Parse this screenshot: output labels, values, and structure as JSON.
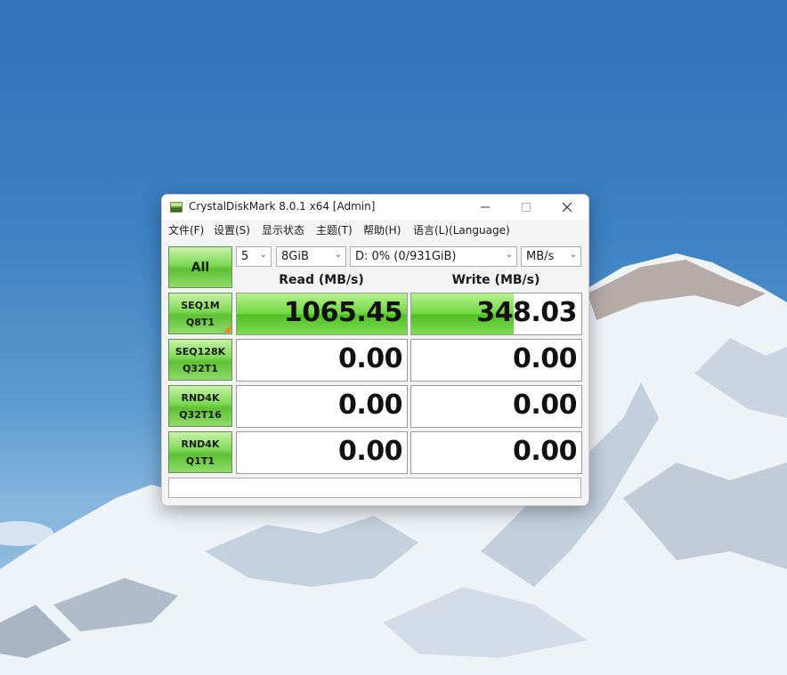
{
  "window": {
    "title": "CrystalDiskMark 8.0.1 x64 [Admin]"
  },
  "menu": [
    {
      "label": "文件(F)"
    },
    {
      "label": "设置(S)"
    },
    {
      "label": "显示状态"
    },
    {
      "label": "主题(T)"
    },
    {
      "label": "帮助(H)"
    },
    {
      "label": "语言(L)(Language)"
    }
  ],
  "controls": {
    "all_label": "All",
    "count_value": "5",
    "size_value": "8GiB",
    "drive_value": "D: 0% (0/931GiB)",
    "unit_value": "MB/s"
  },
  "headers": {
    "read": "Read (MB/s)",
    "write": "Write (MB/s)"
  },
  "tests": [
    {
      "line1": "SEQ1M",
      "line2": "Q8T1",
      "read": "1065.45",
      "write": "348.03",
      "read_fill": 1.0,
      "write_fill": 0.6
    },
    {
      "line1": "SEQ128K",
      "line2": "Q32T1",
      "read": "0.00",
      "write": "0.00",
      "read_fill": 0,
      "write_fill": 0
    },
    {
      "line1": "RND4K",
      "line2": "Q32T16",
      "read": "0.00",
      "write": "0.00",
      "read_fill": 0,
      "write_fill": 0
    },
    {
      "line1": "RND4K",
      "line2": "Q1T1",
      "read": "0.00",
      "write": "0.00",
      "read_fill": 0,
      "write_fill": 0
    }
  ],
  "comment": "",
  "colors": {
    "accent_green": "#5ec034",
    "marker_orange": "#e8822d"
  }
}
